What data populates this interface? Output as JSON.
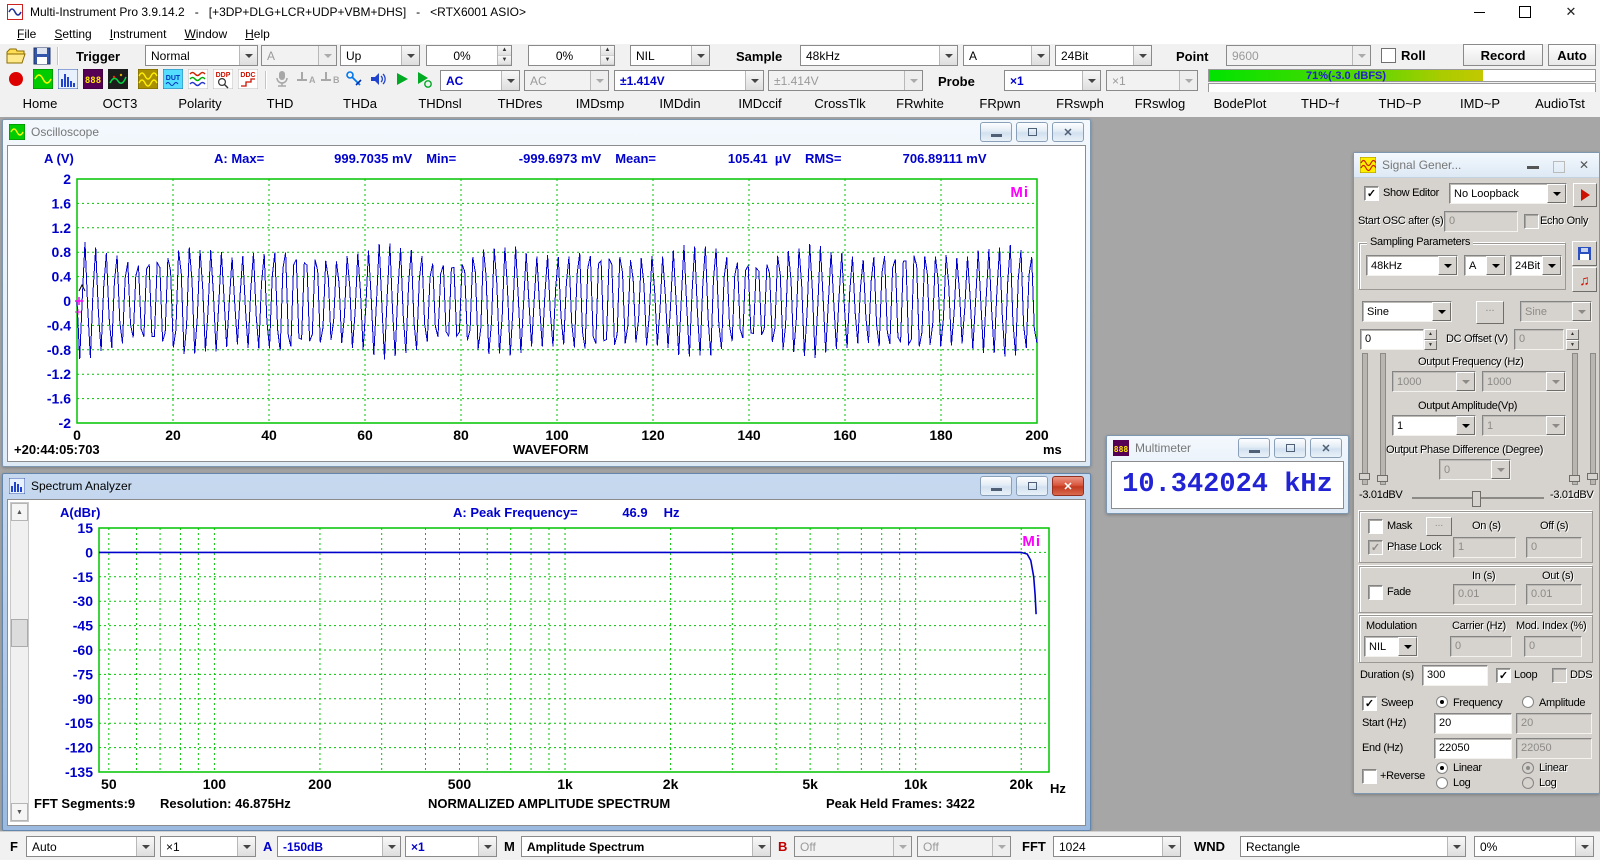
{
  "titlebar": {
    "title": "Multi-Instrument Pro 3.9.14.2   -   [+3DP+DLG+LCR+UDP+VBM+DHS]   -   <RTX6001 ASIO>"
  },
  "menu": {
    "items": [
      "File",
      "Setting",
      "Instrument",
      "Window",
      "Help"
    ]
  },
  "toolbar": {
    "trigger_label": "Trigger",
    "trigger_mode": "Normal",
    "trigger_source": "A",
    "trigger_edge": "Up",
    "trigger_level": "0%",
    "trigger_delay": "0%",
    "trigger_nil": "NIL",
    "sample_label": "Sample",
    "sample_rate": "48kHz",
    "sample_channel": "A",
    "sample_bits": "24Bit",
    "point_label": "Point",
    "point_value": "9600",
    "roll_label": "Roll",
    "record_label": "Record",
    "auto_label": "Auto",
    "coupling_a": "AC",
    "coupling_b": "AC",
    "range_a": "±1.414V",
    "range_b": "±1.414V",
    "probe_label": "Probe",
    "probe_a": "×1",
    "probe_b": "×1",
    "level_meter": "71%(-3.0 dBFS)"
  },
  "tabs": [
    "Home",
    "OCT3",
    "Polarity",
    "THD",
    "THDa",
    "THDnsl",
    "THDres",
    "IMDsmp",
    "IMDdin",
    "IMDccif",
    "CrossTlk",
    "FRwhite",
    "FRpwn",
    "FRswph",
    "FRswlog",
    "BodePlot",
    "THD~f",
    "THD~P",
    "IMD~P",
    "AudioTst"
  ],
  "oscilloscope": {
    "title": "Oscilloscope",
    "ylabel": "A (V)",
    "stats": {
      "prefix": "A: Max=",
      "max": "999.7035 mV",
      "min_label": "Min=",
      "min": "-999.6973 mV",
      "mean_label": "Mean=",
      "mean": "105.41  µV",
      "rms_label": "RMS=",
      "rms": "706.89111 mV"
    },
    "timestamp": "+20:44:05:703",
    "x_title": "WAVEFORM",
    "x_unit": "ms"
  },
  "spectrum": {
    "title": "Spectrum Analyzer",
    "ylabel": "A(dBr)",
    "stats": {
      "prefix": "A: Peak Frequency=",
      "value": "46.9",
      "unit": "Hz"
    },
    "bottom_left1": "FFT Segments:9",
    "bottom_left2": "Resolution: 46.875Hz",
    "x_title": "NORMALIZED AMPLITUDE SPECTRUM",
    "bottom_right": "Peak Held Frames: 3422",
    "x_unit": "Hz"
  },
  "multimeter": {
    "title": "Multimeter",
    "value": "10.342024 kHz"
  },
  "signal_generator": {
    "title": "Signal Gener...",
    "show_editor": "Show Editor",
    "loopback": "No Loopback",
    "start_osc_label": "Start OSC after (s)",
    "start_osc_value": "0",
    "echo_only": "Echo Only",
    "sampling_legend": "Sampling Parameters",
    "rate": "48kHz",
    "channel": "A",
    "bits": "24Bit",
    "wave_a": "Sine",
    "wave_b": "Sine",
    "more": "...",
    "dc_a": "0",
    "dc_label": "DC Offset (V)",
    "dc_b": "0",
    "freq_label": "Output Frequency (Hz)",
    "freq_a": "1000",
    "freq_b": "1000",
    "amp_label": "Output Amplitude(Vp)",
    "amp_a": "1",
    "amp_b": "1",
    "phase_label": "Output Phase Difference (Degree)",
    "phase_value": "0",
    "level_left": "-3.01dBV",
    "level_right": "-3.01dBV",
    "mask_label": "Mask",
    "mask_more": "...",
    "on_label": "On (s)",
    "off_label": "Off (s)",
    "phase_lock": "Phase Lock",
    "on_value": "1",
    "off_value": "0",
    "fade_label": "Fade",
    "in_label": "In (s)",
    "out_label": "Out (s)",
    "in_value": "0.01",
    "out_value": "0.01",
    "modulation_label": "Modulation",
    "carrier_label": "Carrier (Hz)",
    "index_label": "Mod. Index (%)",
    "mod_mode": "NIL",
    "carrier_value": "0",
    "index_value": "0",
    "duration_label": "Duration (s)",
    "duration": "300",
    "loop_label": "Loop",
    "dds_label": "DDS",
    "sweep_label": "Sweep",
    "frequency_label": "Frequency",
    "amplitude_label": "Amplitude",
    "start_label": "Start (Hz)",
    "start_a": "20",
    "start_b": "20",
    "end_label": "End (Hz)",
    "end_a": "22050",
    "end_b": "22050",
    "reverse_label": "+Reverse",
    "linear_a": "Linear",
    "log_a": "Log",
    "linear_b": "Linear",
    "log_b": "Log"
  },
  "statusbar": {
    "f_label": "F",
    "f_mode": "Auto",
    "f_gain": "×1",
    "a_label": "A",
    "a_range": "-150dB",
    "a_gain": "×1",
    "m_label": "M",
    "m_mode": "Amplitude Spectrum",
    "b_label": "B",
    "b_mode": "Off",
    "b_mode2": "Off",
    "fft_label": "FFT",
    "fft_size": "1024",
    "wnd_label": "WND",
    "wnd_type": "Rectangle",
    "overlap": "0%"
  },
  "chart_data": [
    {
      "id": "oscilloscope_waveform",
      "type": "line",
      "title": "WAVEFORM",
      "x_unit": "ms",
      "xlim": [
        0,
        200
      ],
      "xticks": [
        0,
        20,
        40,
        60,
        80,
        100,
        120,
        140,
        160,
        180,
        200
      ],
      "ylabel": "A (V)",
      "ylim": [
        -2,
        2
      ],
      "yticks": [
        "2",
        "1.6",
        "1.2",
        "0.8",
        "0.4",
        "0",
        "-0.4",
        "-0.8",
        "-1.2",
        "-1.6",
        "-2"
      ],
      "grid": true,
      "grid_color": "#00c400",
      "series": [
        {
          "name": "A",
          "color": "#0000cc",
          "signal": "sine",
          "frequency_hz": 10342,
          "amplitude_v": 1.0,
          "sample_rate_hz": 48000,
          "record_points": 9600,
          "display_points": 360,
          "display_sample_rate_hz": 1800,
          "envelope_base": 0.84,
          "envelope_beat": 0.1,
          "envelope_rate": 9.3
        }
      ],
      "stats": {
        "max_mv": 999.7035,
        "min_mv": -999.6973,
        "mean_uv": 105.41,
        "rms_mv": 706.89111
      },
      "timestamp": "+20:44:05:703"
    },
    {
      "id": "spectrum",
      "type": "line",
      "title": "NORMALIZED AMPLITUDE SPECTRUM",
      "x_unit": "Hz",
      "x_scale": "log",
      "xlim": [
        46.875,
        24000
      ],
      "xtick_values": [
        50,
        100,
        200,
        500,
        1000,
        2000,
        5000,
        10000,
        20000
      ],
      "xtick_labels": [
        "50",
        "100",
        "200",
        "500",
        "1k",
        "2k",
        "5k",
        "10k",
        "20k"
      ],
      "minor_grid_x": [
        50,
        60,
        70,
        80,
        90,
        100,
        200,
        300,
        400,
        500,
        600,
        700,
        800,
        900,
        1000,
        2000,
        3000,
        4000,
        5000,
        6000,
        7000,
        8000,
        9000,
        10000,
        20000
      ],
      "ylabel": "A(dBr)",
      "ylim": [
        -135,
        15
      ],
      "yticks": [
        15,
        0,
        -15,
        -30,
        -45,
        -60,
        -75,
        -90,
        -105,
        -120,
        -135
      ],
      "grid": true,
      "grid_color": "#00c400",
      "series": [
        {
          "name": "A",
          "color": "#0000cc",
          "points": [
            [
              46.9,
              0
            ],
            [
              20000,
              0
            ],
            [
              20800,
              -1
            ],
            [
              21300,
              -5
            ],
            [
              21700,
              -15
            ],
            [
              21900,
              -26
            ],
            [
              22050,
              -38
            ]
          ]
        }
      ],
      "peak_frequency_hz": 46.9,
      "fft_segments": 9,
      "resolution_hz": 46.875,
      "peak_held_frames": 3422
    }
  ]
}
